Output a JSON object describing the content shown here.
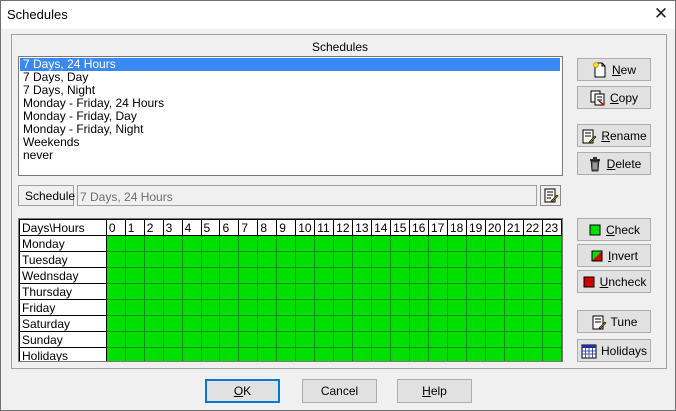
{
  "window": {
    "title": "Schedules",
    "close_glyph": "✕"
  },
  "group": {
    "title": "Schedules"
  },
  "schedules": {
    "items": [
      {
        "label": "7 Days, 24 Hours",
        "selected": true
      },
      {
        "label": "7 Days, Day",
        "selected": false
      },
      {
        "label": "7 Days, Night",
        "selected": false
      },
      {
        "label": "Monday - Friday, 24 Hours",
        "selected": false
      },
      {
        "label": "Monday - Friday, Day",
        "selected": false
      },
      {
        "label": "Monday - Friday, Night",
        "selected": false
      },
      {
        "label": "Weekends",
        "selected": false
      },
      {
        "label": "never",
        "selected": false
      }
    ]
  },
  "schedule_field": {
    "label": "Schedule",
    "value": "7 Days, 24 Hours"
  },
  "side_buttons": {
    "new": {
      "mnemonic": "N",
      "rest": "ew",
      "icon": "new-document-icon"
    },
    "copy": {
      "mnemonic": "C",
      "rest": "opy",
      "icon": "copy-icon"
    },
    "rename": {
      "mnemonic": "R",
      "rest": "ename",
      "icon": "rename-icon"
    },
    "delete": {
      "mnemonic": "D",
      "rest": "elete",
      "icon": "trash-icon"
    },
    "check": {
      "mnemonic": "C",
      "rest": "heck",
      "icon": "check-green-icon"
    },
    "invert": {
      "mnemonic": "I",
      "rest": "nvert",
      "icon": "invert-icon"
    },
    "uncheck": {
      "mnemonic": "U",
      "rest": "ncheck",
      "icon": "uncheck-red-icon"
    },
    "tune": {
      "label": "Tune",
      "icon": "tune-icon"
    },
    "holidays": {
      "label": "Holidays",
      "icon": "calendar-icon"
    }
  },
  "grid": {
    "corner_label": "Days\\Hours",
    "hours": [
      "0",
      "1",
      "2",
      "3",
      "4",
      "5",
      "6",
      "7",
      "8",
      "9",
      "10",
      "11",
      "12",
      "13",
      "14",
      "15",
      "16",
      "17",
      "18",
      "19",
      "20",
      "21",
      "22",
      "23"
    ],
    "days": [
      "Monday",
      "Tuesday",
      "Wednsday",
      "Thursday",
      "Friday",
      "Saturday",
      "Sunday",
      "Holidays"
    ],
    "all_checked": true
  },
  "bottom_buttons": {
    "ok": {
      "mnemonic": "O",
      "rest": "K"
    },
    "cancel": {
      "label": "Cancel"
    },
    "help": {
      "mnemonic": "H",
      "rest": "elp"
    }
  },
  "colors": {
    "checked_cell": "#00e000",
    "selection": "#3a88f4"
  }
}
